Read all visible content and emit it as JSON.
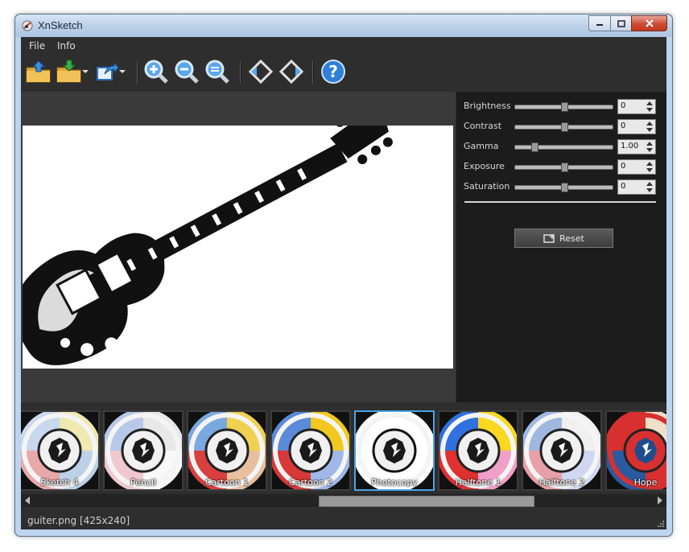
{
  "window": {
    "title": "XnSketch"
  },
  "menu": [
    "File",
    "Info"
  ],
  "toolbar": [
    {
      "icon": "open-folder-icon"
    },
    {
      "icon": "save-folder-icon"
    },
    {
      "icon": "export-icon"
    },
    {
      "icon": "zoom-in-icon"
    },
    {
      "icon": "zoom-out-icon"
    },
    {
      "icon": "zoom-fit-icon"
    },
    {
      "icon": "rotate-left-icon"
    },
    {
      "icon": "rotate-right-icon"
    },
    {
      "icon": "help-icon"
    }
  ],
  "adjustments": [
    {
      "label": "Brightness",
      "value": "0",
      "level": 0.5
    },
    {
      "label": "Contrast",
      "value": "0",
      "level": 0.5
    },
    {
      "label": "Gamma",
      "value": "1.00",
      "level": 0.2
    },
    {
      "label": "Exposure",
      "value": "0",
      "level": 0.5
    },
    {
      "label": "Saturation",
      "value": "0",
      "level": 0.5
    }
  ],
  "reset_label": "Reset",
  "filters": [
    {
      "label": "Sketch 4",
      "selected": false
    },
    {
      "label": "Pencil",
      "selected": false
    },
    {
      "label": "Cartoon 1",
      "selected": false
    },
    {
      "label": "Cartoon 2",
      "selected": false
    },
    {
      "label": "Photocopy",
      "selected": true
    },
    {
      "label": "Halftone 1",
      "selected": false
    },
    {
      "label": "Halftone 2",
      "selected": false
    },
    {
      "label": "Hope",
      "selected": false
    }
  ],
  "status": "guiter.png [425x240]",
  "colors": {
    "accent": "#4aa3e8",
    "background": "#2e2e2e"
  }
}
